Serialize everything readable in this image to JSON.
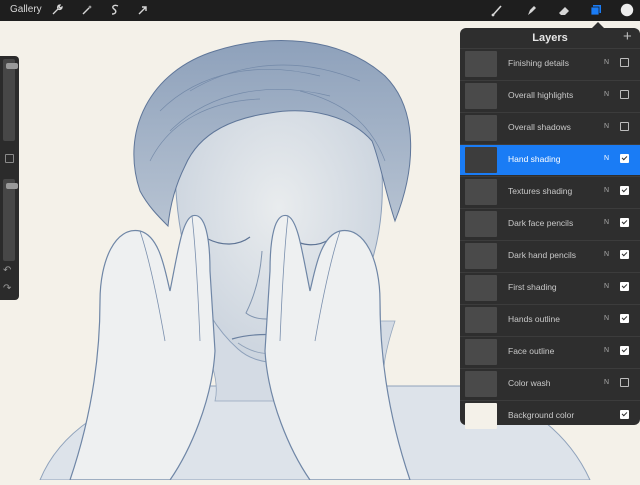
{
  "topbar": {
    "gallery_label": "Gallery",
    "tools": [
      {
        "name": "wrench-icon"
      },
      {
        "name": "magic-wand-icon"
      },
      {
        "name": "selection-icon"
      },
      {
        "name": "transform-arrow-icon"
      }
    ],
    "right_tools": [
      {
        "name": "brush-icon"
      },
      {
        "name": "smudge-icon"
      },
      {
        "name": "eraser-icon"
      },
      {
        "name": "layers-icon",
        "active": true
      },
      {
        "name": "color-swatch"
      }
    ],
    "accent_color": "#1a7cf5"
  },
  "layers_panel": {
    "title": "Layers",
    "add_button": "+",
    "layers": [
      {
        "name": "Finishing details",
        "blend": "N",
        "visible": false,
        "active": false
      },
      {
        "name": "Overall highlights",
        "blend": "N",
        "visible": false,
        "active": false
      },
      {
        "name": "Overall shadows",
        "blend": "N",
        "visible": false,
        "active": false
      },
      {
        "name": "Hand shading",
        "blend": "N",
        "visible": true,
        "active": true
      },
      {
        "name": "Textures shading",
        "blend": "N",
        "visible": true,
        "active": false
      },
      {
        "name": "Dark face pencils",
        "blend": "N",
        "visible": true,
        "active": false
      },
      {
        "name": "Dark hand pencils",
        "blend": "N",
        "visible": true,
        "active": false
      },
      {
        "name": "First shading",
        "blend": "N",
        "visible": true,
        "active": false
      },
      {
        "name": "Hands outline",
        "blend": "N",
        "visible": true,
        "active": false
      },
      {
        "name": "Face outline",
        "blend": "N",
        "visible": true,
        "active": false
      },
      {
        "name": "Color wash",
        "blend": "N",
        "visible": false,
        "active": false
      },
      {
        "name": "Background color",
        "blend": "",
        "visible": true,
        "active": false
      }
    ]
  },
  "sidebar": {
    "brush_size": 0.05,
    "brush_opacity": 0.05,
    "undo_icon": "undo-icon",
    "redo_icon": "redo-icon"
  },
  "canvas": {
    "background_color": "#f4f1e9",
    "line_color": "#6f86a6"
  }
}
